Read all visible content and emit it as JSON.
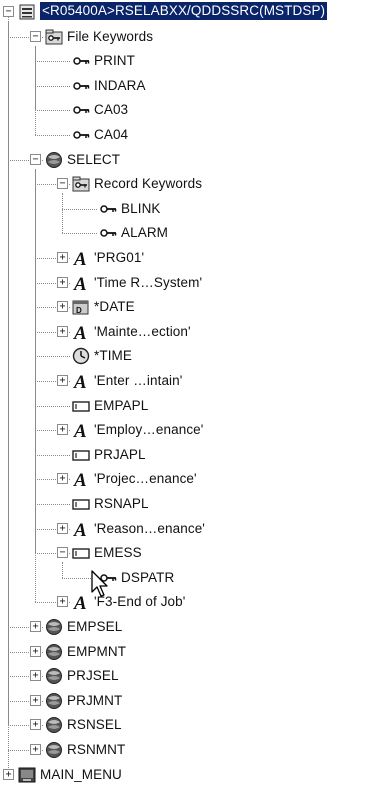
{
  "tree": {
    "nodes": [
      {
        "depth": 0,
        "toggle": "-",
        "icon": "file-source-icon",
        "label": "<R05400A>RSELABXX/QDDSSRC(MSTDSP)",
        "selected": true
      },
      {
        "depth": 1,
        "toggle": "-",
        "icon": "keyword-folder-icon",
        "label": "File Keywords"
      },
      {
        "depth": 2,
        "toggle": "",
        "icon": "key-icon",
        "label": "PRINT"
      },
      {
        "depth": 2,
        "toggle": "",
        "icon": "key-icon",
        "label": "INDARA"
      },
      {
        "depth": 2,
        "toggle": "",
        "icon": "key-icon",
        "label": "CA03"
      },
      {
        "depth": 2,
        "toggle": "",
        "icon": "key-icon",
        "label": "CA04"
      },
      {
        "depth": 1,
        "toggle": "-",
        "icon": "record-format-icon",
        "label": "SELECT"
      },
      {
        "depth": 2,
        "toggle": "-",
        "icon": "keyword-folder-icon",
        "label": "Record Keywords"
      },
      {
        "depth": 3,
        "toggle": "",
        "icon": "key-icon",
        "label": "BLINK"
      },
      {
        "depth": 3,
        "toggle": "",
        "icon": "key-icon",
        "label": "ALARM"
      },
      {
        "depth": 2,
        "toggle": "+",
        "icon": "constant-text-icon",
        "label": "'PRG01'"
      },
      {
        "depth": 2,
        "toggle": "+",
        "icon": "constant-text-icon",
        "label": "'Time R…System'"
      },
      {
        "depth": 2,
        "toggle": "+",
        "icon": "date-icon",
        "label": "*DATE"
      },
      {
        "depth": 2,
        "toggle": "+",
        "icon": "constant-text-icon",
        "label": "'Mainte…ection'"
      },
      {
        "depth": 2,
        "toggle": "",
        "icon": "clock-icon",
        "label": "*TIME"
      },
      {
        "depth": 2,
        "toggle": "+",
        "icon": "constant-text-icon",
        "label": "'Enter …intain'"
      },
      {
        "depth": 2,
        "toggle": "",
        "icon": "field-icon",
        "label": "EMPAPL"
      },
      {
        "depth": 2,
        "toggle": "+",
        "icon": "constant-text-icon",
        "label": "'Employ…enance'"
      },
      {
        "depth": 2,
        "toggle": "",
        "icon": "field-icon",
        "label": "PRJAPL"
      },
      {
        "depth": 2,
        "toggle": "+",
        "icon": "constant-text-icon",
        "label": "'Projec…enance'"
      },
      {
        "depth": 2,
        "toggle": "",
        "icon": "field-icon",
        "label": "RSNAPL"
      },
      {
        "depth": 2,
        "toggle": "+",
        "icon": "constant-text-icon",
        "label": "'Reason…enance'"
      },
      {
        "depth": 2,
        "toggle": "-",
        "icon": "field-icon",
        "label": "EMESS"
      },
      {
        "depth": 3,
        "toggle": "",
        "icon": "key-icon",
        "label": "DSPATR"
      },
      {
        "depth": 2,
        "toggle": "+",
        "icon": "constant-text-icon",
        "label": "'F3-End of Job'"
      },
      {
        "depth": 1,
        "toggle": "+",
        "icon": "record-format-icon",
        "label": "EMPSEL"
      },
      {
        "depth": 1,
        "toggle": "+",
        "icon": "record-format-icon",
        "label": "EMPMNT"
      },
      {
        "depth": 1,
        "toggle": "+",
        "icon": "record-format-icon",
        "label": "PRJSEL"
      },
      {
        "depth": 1,
        "toggle": "+",
        "icon": "record-format-icon",
        "label": "PRJMNT"
      },
      {
        "depth": 1,
        "toggle": "+",
        "icon": "record-format-icon",
        "label": "RSNSEL"
      },
      {
        "depth": 1,
        "toggle": "+",
        "icon": "record-format-icon",
        "label": "RSNMNT"
      },
      {
        "depth": 0,
        "toggle": "+",
        "icon": "menu-file-icon",
        "label": "MAIN_MENU"
      }
    ]
  },
  "colors": {
    "selection_bg": "#0a246a",
    "selection_fg": "#ffffff",
    "tree_line": "#8a8a8a"
  },
  "cursor": {
    "icon": "mouse-pointer-icon"
  }
}
